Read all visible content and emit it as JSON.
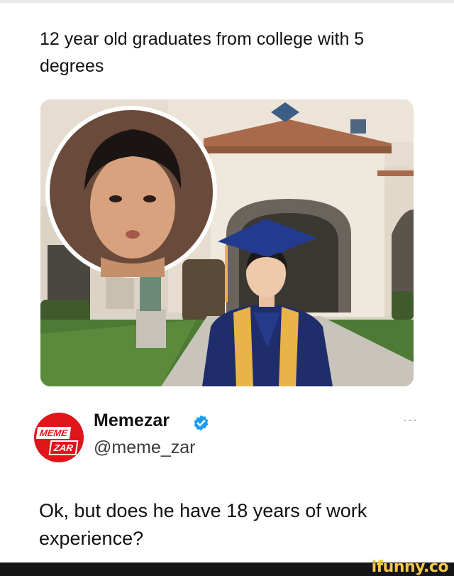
{
  "post": {
    "headline": "12 year old graduates from college with 5 degrees",
    "author": {
      "name": "Memezar",
      "handle": "@meme_zar",
      "avatar_logo_top": "MEME",
      "avatar_logo_bottom": "ZAR",
      "verified": true
    },
    "more_label": "···",
    "body": "Ok, but does he have 18 years of work experience?"
  },
  "watermark": {
    "text": "ifunny.co"
  },
  "colors": {
    "brand_red": "#e0141b",
    "verified_blue": "#1d9bf0",
    "gown_navy": "#1f2d6b",
    "stole_gold": "#e8b44a"
  }
}
